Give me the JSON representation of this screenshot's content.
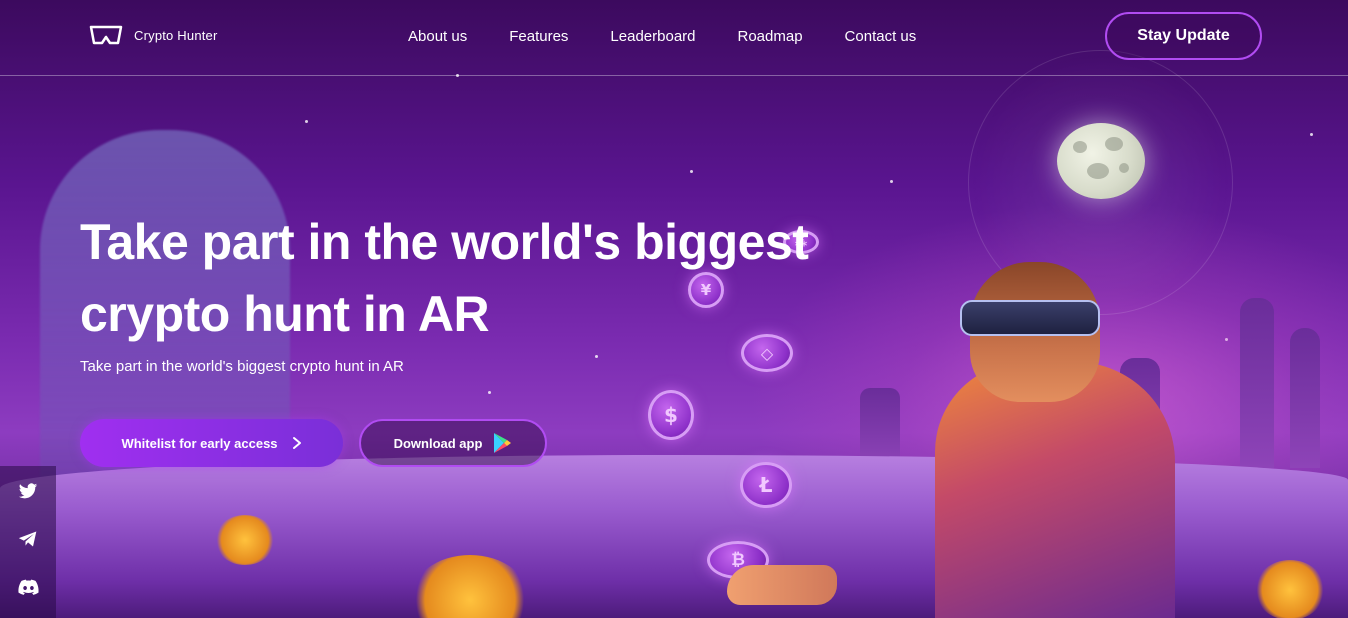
{
  "brand": {
    "name": "Crypto Hunter"
  },
  "nav": {
    "items": [
      {
        "label": "About us"
      },
      {
        "label": "Features"
      },
      {
        "label": "Leaderboard"
      },
      {
        "label": "Roadmap"
      },
      {
        "label": "Contact us"
      }
    ],
    "cta_label": "Stay Update"
  },
  "hero": {
    "title_line1": "Take part in the world's biggest",
    "title_line2": "crypto hunt in AR",
    "subtitle": "Take part in the world's biggest crypto hunt in AR",
    "primary_button": "Whitelist for early access",
    "secondary_button": "Download app"
  },
  "social": {
    "icons": [
      "twitter-icon",
      "telegram-icon",
      "discord-icon"
    ]
  },
  "colors": {
    "accent": "#a02ff0",
    "border_accent": "#b14cf2",
    "background_top": "#3c0a5e",
    "background_mid": "#8d3cc0"
  }
}
